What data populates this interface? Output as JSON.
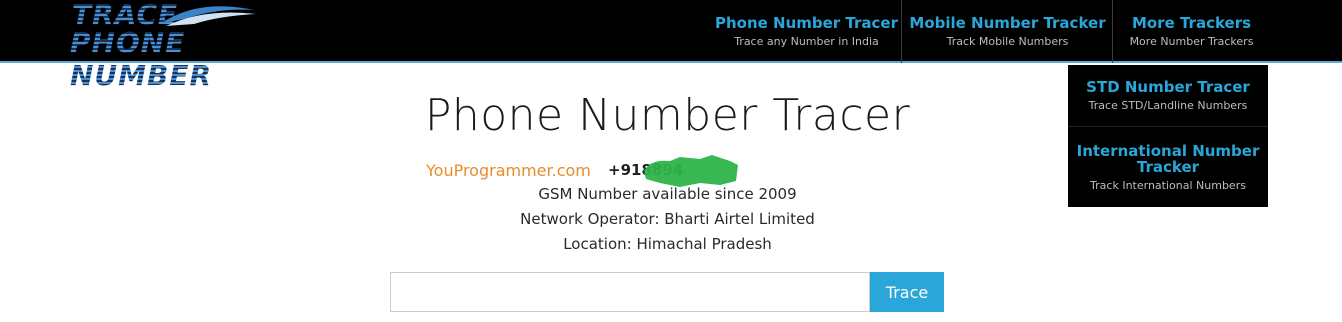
{
  "logo": {
    "line1": "TRACE",
    "line2": "PHONE NUMBER"
  },
  "nav": [
    {
      "title": "Phone Number Tracer",
      "subtitle": "Trace any Number in India"
    },
    {
      "title": "Mobile Number Tracker",
      "subtitle": "Track Mobile Numbers"
    },
    {
      "title": "More Trackers",
      "subtitle": "More Number Trackers"
    }
  ],
  "dropdown": [
    {
      "title": "STD Number Tracer",
      "subtitle": "Trace STD/Landline Numbers"
    },
    {
      "title": "International Number Tracker",
      "subtitle": "Track International Numbers"
    }
  ],
  "main": {
    "title": "Phone Number Tracer",
    "watermark": "YouProgrammer.com",
    "number": "+918894",
    "info": [
      "GSM Number available since 2009",
      "Network Operator: Bharti Airtel Limited",
      "Location: Himachal Pradesh"
    ],
    "search_value": "",
    "button_label": "Trace"
  },
  "colors": {
    "accent": "#2aa6d9",
    "topbar": "#000000",
    "watermark": "#e98b2c",
    "redaction": "#2db34a"
  }
}
